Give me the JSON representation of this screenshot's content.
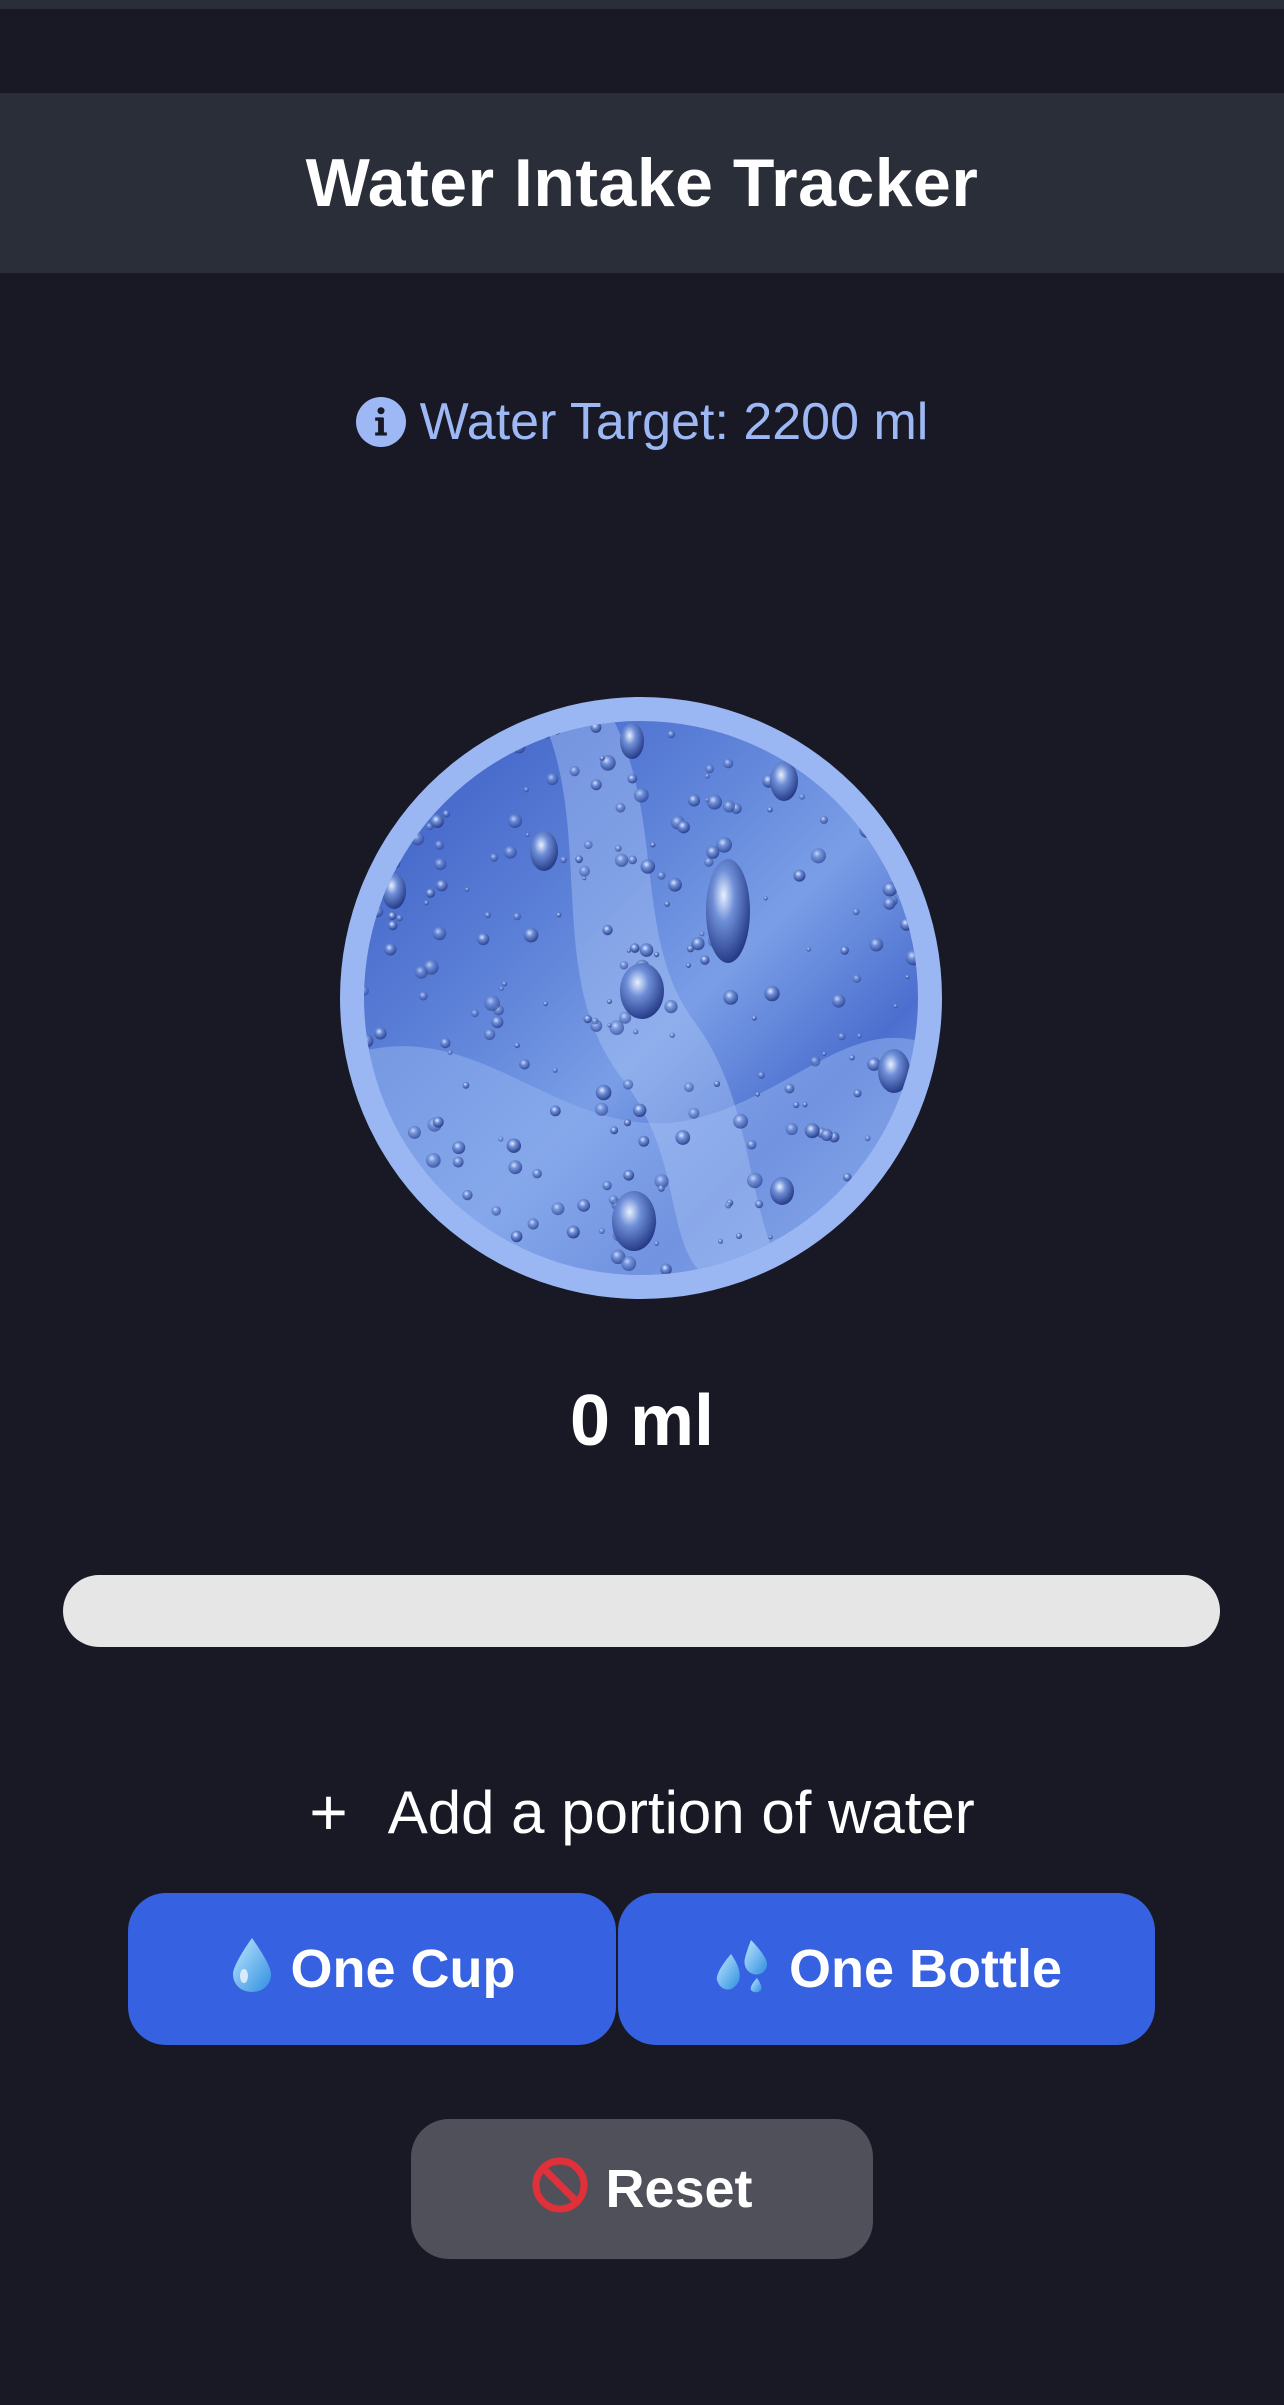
{
  "header": {
    "title": "Water Intake Tracker"
  },
  "target": {
    "icon": "info-icon",
    "text": "Water Target: 2200 ml"
  },
  "intake": {
    "amount": "0 ml",
    "progress_fraction": 0
  },
  "add": {
    "icon": "plus-icon",
    "label": "Add a portion of water"
  },
  "buttons": {
    "cup": {
      "icon": "droplet-icon",
      "label": "One Cup"
    },
    "bottle": {
      "icon": "sweat-droplets-icon",
      "label": "One Bottle"
    },
    "reset": {
      "icon": "prohibited-icon",
      "label": "Reset"
    }
  },
  "colors": {
    "background": "#181925",
    "header": "#2a2e38",
    "accent": "#3661e0",
    "target_text": "#9db8f4",
    "circle_border": "#9ab7f3",
    "progress_track": "#e6e6e6",
    "reset_button": "#4f5059"
  }
}
